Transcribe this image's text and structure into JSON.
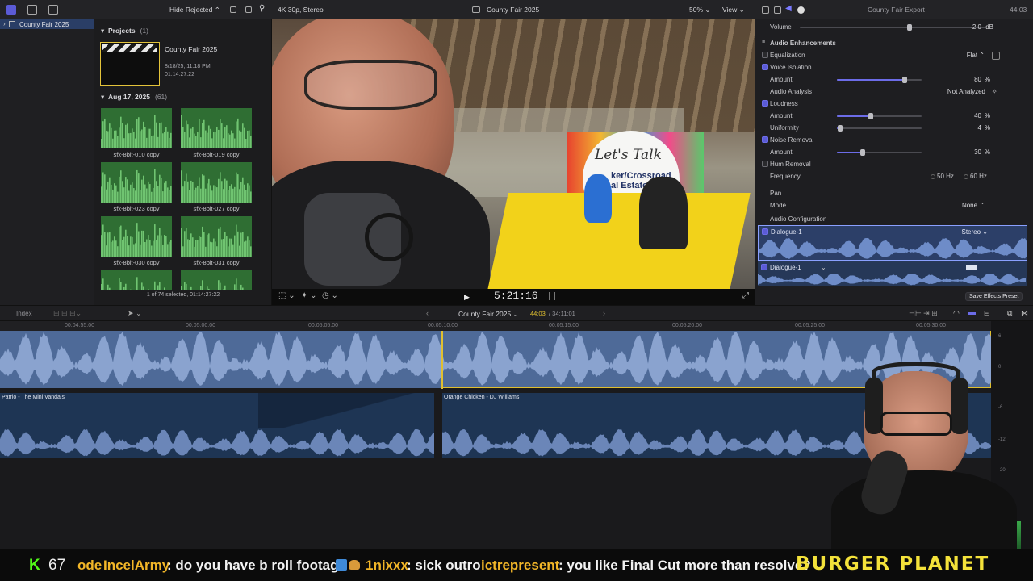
{
  "toolbar": {
    "filter_label": "Hide Rejected",
    "format_label": "4K 30p, Stereo",
    "project_title": "County Fair 2025",
    "zoom": "50%",
    "view_label": "View",
    "inspector_title": "County Fair Export",
    "inspector_time": "44:03"
  },
  "library": {
    "name": "County Fair 2025"
  },
  "browser": {
    "projects_header": "Projects",
    "projects_count": "(1)",
    "project": {
      "name": "County Fair 2025",
      "date": "8/18/25, 11:18 PM",
      "duration": "01:14:27:22"
    },
    "event_header": "Aug 17, 2025",
    "event_count": "(61)",
    "clips": [
      {
        "label": "sfx-8bit-010 copy"
      },
      {
        "label": "sfx-8bit-019 copy"
      },
      {
        "label": "sfx-8bit-023 copy"
      },
      {
        "label": "sfx-8bit-027 copy"
      },
      {
        "label": "sfx-8bit-030 copy"
      },
      {
        "label": "sfx-8bit-031 copy"
      },
      {
        "label": ""
      },
      {
        "label": ""
      }
    ],
    "selection_status": "1 of 74 selected, 01:14:27:22"
  },
  "viewer": {
    "timecode": "5:21:16",
    "sign_text": "Let's Talk",
    "banner_text": "ker/Crossroad\nal Estate"
  },
  "inspector": {
    "volume_label": "Volume",
    "volume_value": "-2.0",
    "volume_unit": "dB",
    "enhancements_header": "Audio Enhancements",
    "equalization_label": "Equalization",
    "equalization_value": "Flat",
    "voice_isolation_label": "Voice Isolation",
    "voice_amount_label": "Amount",
    "voice_amount_value": "80",
    "voice_amount_pct": 0.8,
    "audio_analysis_label": "Audio Analysis",
    "audio_analysis_value": "Not Analyzed",
    "loudness_label": "Loudness",
    "loudness_amount_label": "Amount",
    "loudness_amount_value": "40",
    "loudness_amount_pct": 0.4,
    "uniformity_label": "Uniformity",
    "uniformity_value": "4",
    "uniformity_pct": 0.04,
    "noise_removal_label": "Noise Removal",
    "noise_amount_label": "Amount",
    "noise_amount_value": "30",
    "noise_amount_pct": 0.3,
    "hum_removal_label": "Hum Removal",
    "frequency_label": "Frequency",
    "freq_50": "50 Hz",
    "freq_60": "60 Hz",
    "pan_header": "Pan",
    "mode_label": "Mode",
    "mode_value": "None",
    "config_header": "Audio Configuration",
    "channel1_label": "Dialogue-1",
    "channel1_format": "Stereo",
    "channel2_label": "Dialogue-1",
    "save_preset_label": "Save Effects Preset",
    "pct_unit": "%"
  },
  "timeline": {
    "index_label": "Index",
    "project_name": "County Fair 2025",
    "position": "44:03",
    "duration": "/ 34:11:01",
    "ruler": [
      "00:04:55:00",
      "00:05:00:00",
      "00:05:05:00",
      "00:05:10:00",
      "00:05:15:00",
      "00:05:20:00",
      "00:05:25:00",
      "00:05:30:00"
    ],
    "clip_left_name": "Patrio - The Mini Vandals",
    "clip_right_name": "Orange Chicken - DJ Williams",
    "meter_labels": [
      "6",
      "0",
      "-6",
      "-12",
      "-20"
    ]
  },
  "ticker": {
    "viewer_count": "67",
    "items": [
      {
        "user": "ode",
        "message": ""
      },
      {
        "user": "IncelArmy",
        "message": ": do you have b roll footage"
      },
      {
        "user": "1nixxx",
        "message": ": sick outro"
      },
      {
        "user": "ictrepresent",
        "message": ": you like Final Cut more than resolve?"
      }
    ],
    "brand": "BURGER PLANET"
  },
  "colors": {
    "accent": "#6c6ce8",
    "clip_blue": "#4e6a98",
    "bgm_blue": "#1e3554",
    "playhead": "#e0c030",
    "skimmer": "#e04040",
    "thumb_green": "#2f6e33",
    "ticker_user": "#f2b628",
    "brand_yellow": "#f4e23a"
  }
}
